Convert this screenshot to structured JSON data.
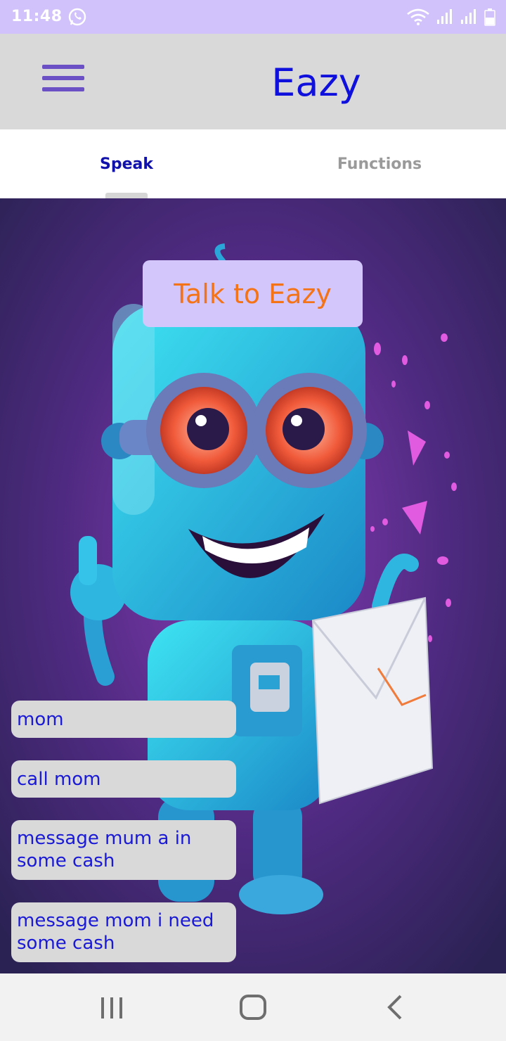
{
  "status_bar": {
    "time": "11:48",
    "icons": [
      "whatsapp-icon",
      "wifi-icon",
      "signal-icon",
      "signal-icon",
      "battery-icon"
    ],
    "background": "#d2c2fb"
  },
  "app_bar": {
    "title": "Eazy",
    "menu_icon": "hamburger-menu-icon",
    "title_color": "#1010dd"
  },
  "tabs": [
    {
      "label": "Speak",
      "selected": true
    },
    {
      "label": "Functions",
      "selected": false
    }
  ],
  "main": {
    "talk_button_label": "Talk to Eazy",
    "talk_button_color": "#f47317",
    "history": [
      "mom",
      "call mom",
      "message mum a in some cash",
      "message mom i need some cash"
    ]
  },
  "nav_bar": {
    "buttons": [
      "recent-apps-icon",
      "home-icon",
      "back-icon"
    ]
  }
}
